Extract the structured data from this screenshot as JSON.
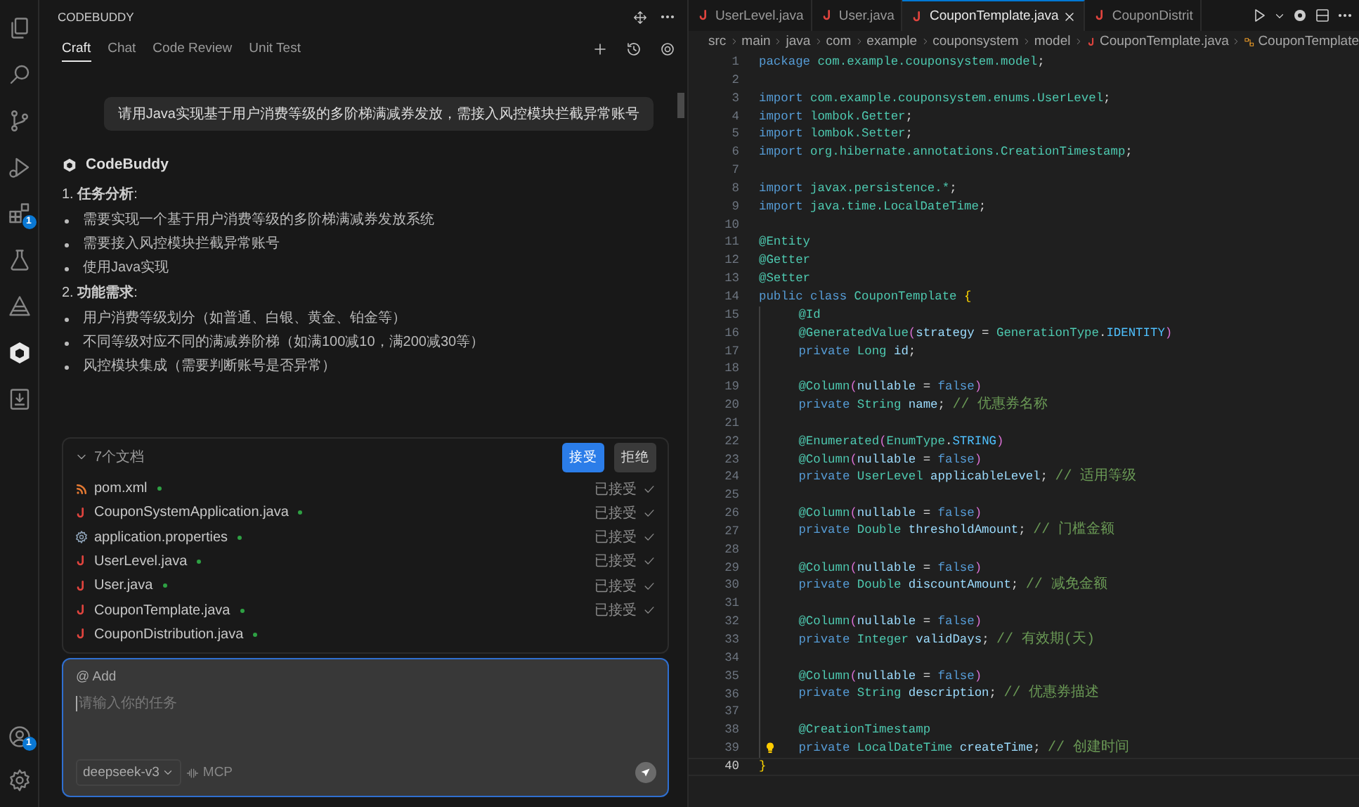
{
  "activity_bar": {
    "items": [
      {
        "kind": "files",
        "selected": false
      },
      {
        "kind": "search",
        "selected": false
      },
      {
        "kind": "branch",
        "selected": false
      },
      {
        "kind": "run",
        "selected": false
      },
      {
        "kind": "extensions",
        "selected": false,
        "badge": "1"
      },
      {
        "kind": "flask",
        "selected": false
      },
      {
        "kind": "triangle",
        "selected": false
      },
      {
        "kind": "cube",
        "selected": true
      },
      {
        "kind": "download",
        "selected": false
      }
    ],
    "bottom": [
      {
        "kind": "account",
        "badge": "1"
      },
      {
        "kind": "settings"
      }
    ]
  },
  "panel": {
    "title": "CODEBUDDY",
    "tabs": [
      {
        "label": "Craft",
        "selected": true
      },
      {
        "label": "Chat",
        "selected": false
      },
      {
        "label": "Code Review",
        "selected": false
      },
      {
        "label": "Unit Test",
        "selected": false
      }
    ],
    "chat": {
      "user_message": "请用Java实现基于用户消费等级的多阶梯满减券发放，需接入风控模块拦截异常账号",
      "assistant": "CodeBuddy",
      "blocks": [
        {
          "kind": "heading",
          "text": "1. **任务分析**:"
        },
        {
          "kind": "bullet",
          "text": "需要实现一个基于用户消费等级的多阶梯满减券发放系统"
        },
        {
          "kind": "bullet",
          "text": "需要接入风控模块拦截异常账号"
        },
        {
          "kind": "bullet",
          "text": "使用Java实现"
        },
        {
          "kind": "heading",
          "text": "2. **功能需求**:"
        },
        {
          "kind": "bullet",
          "text": "用户消费等级划分（如普通、白银、黄金、铂金等）"
        },
        {
          "kind": "bullet",
          "text": "不同等级对应不同的满减券阶梯（如满100减10，满200减30等）"
        },
        {
          "kind": "bullet",
          "text": "风控模块集成（需要判断账号是否异常）"
        }
      ]
    },
    "changes": {
      "title": "7个文档",
      "expanded": true,
      "accept": "接受",
      "reject": "拒绝",
      "files": [
        {
          "name": "pom.xml",
          "kind": "xml",
          "modified": true,
          "status": "已接受"
        },
        {
          "name": "CouponSystemApplication.java",
          "kind": "java",
          "modified": true,
          "status": "已接受"
        },
        {
          "name": "application.properties",
          "kind": "config",
          "modified": true,
          "status": "已接受"
        },
        {
          "name": "UserLevel.java",
          "kind": "java",
          "modified": true,
          "status": "已接受"
        },
        {
          "name": "User.java",
          "kind": "java",
          "modified": true,
          "status": "已接受"
        },
        {
          "name": "CouponTemplate.java",
          "kind": "java",
          "modified": true,
          "status": "已接受"
        },
        {
          "name": "CouponDistribution.java",
          "kind": "java",
          "modified": true
        }
      ]
    },
    "input": {
      "mention": "@ Add",
      "placeholder": "请输入你的任务",
      "model": "deepseek-v3",
      "tool": "MCP"
    }
  },
  "editor": {
    "tabs": [
      {
        "label": "UserLevel.java",
        "selected": false
      },
      {
        "label": "User.java",
        "selected": false
      },
      {
        "label": "CouponTemplate.java",
        "selected": true
      },
      {
        "label": "CouponDistrit",
        "selected": false
      }
    ],
    "breadcrumb": [
      {
        "text": "src",
        "kind": "folder"
      },
      {
        "text": "main",
        "kind": "folder"
      },
      {
        "text": "java",
        "kind": "folder"
      },
      {
        "text": "com",
        "kind": "folder"
      },
      {
        "text": "example",
        "kind": "folder"
      },
      {
        "text": "couponsystem",
        "kind": "folder"
      },
      {
        "text": "model",
        "kind": "folder"
      },
      {
        "text": "CouponTemplate.java",
        "kind": "file"
      },
      {
        "text": "CouponTemplate",
        "kind": "class"
      }
    ],
    "lines": [
      {
        "n": "1",
        "tokens": [
          {
            "text": "package",
            "kind": "kw"
          },
          {
            "text": " com.example.couponsystem.model",
            "kind": "ns"
          },
          {
            "text": ";",
            "kind": "p"
          }
        ]
      },
      {
        "n": "2"
      },
      {
        "n": "3",
        "tokens": [
          {
            "text": "import",
            "kind": "kw"
          },
          {
            "text": " com.example.couponsystem.enums.UserLevel",
            "kind": "ns"
          },
          {
            "text": ";",
            "kind": "p"
          }
        ]
      },
      {
        "n": "4",
        "tokens": [
          {
            "text": "import",
            "kind": "kw"
          },
          {
            "text": " lombok.Getter",
            "kind": "ns"
          },
          {
            "text": ";",
            "kind": "p"
          }
        ]
      },
      {
        "n": "5",
        "tokens": [
          {
            "text": "import",
            "kind": "kw"
          },
          {
            "text": " lombok.Setter",
            "kind": "ns"
          },
          {
            "text": ";",
            "kind": "p"
          }
        ]
      },
      {
        "n": "6",
        "tokens": [
          {
            "text": "import",
            "kind": "kw"
          },
          {
            "text": " org.hibernate.annotations.CreationTimestamp",
            "kind": "ns"
          },
          {
            "text": ";",
            "kind": "p"
          }
        ]
      },
      {
        "n": "7"
      },
      {
        "n": "8",
        "tokens": [
          {
            "text": "import",
            "kind": "kw"
          },
          {
            "text": " javax.persistence.*",
            "kind": "ns"
          },
          {
            "text": ";",
            "kind": "p"
          }
        ]
      },
      {
        "n": "9",
        "tokens": [
          {
            "text": "import",
            "kind": "kw"
          },
          {
            "text": " java.time.LocalDateTime",
            "kind": "ns"
          },
          {
            "text": ";",
            "kind": "p"
          }
        ]
      },
      {
        "n": "10"
      },
      {
        "n": "11",
        "tokens": [
          {
            "text": "@Entity",
            "kind": "ann"
          }
        ]
      },
      {
        "n": "12",
        "tokens": [
          {
            "text": "@Getter",
            "kind": "ann"
          }
        ]
      },
      {
        "n": "13",
        "tokens": [
          {
            "text": "@Setter",
            "kind": "ann"
          }
        ]
      },
      {
        "n": "14",
        "tokens": [
          {
            "text": "public class",
            "kind": "kw"
          },
          {
            "text": " CouponTemplate",
            "kind": "type"
          },
          {
            "text": " {",
            "kind": "br"
          }
        ]
      },
      {
        "n": "15",
        "guide": true,
        "tokens": [
          {
            "text": "@Id",
            "kind": "ann"
          }
        ]
      },
      {
        "n": "16",
        "guide": true,
        "tokens": [
          {
            "text": "@GeneratedValue",
            "kind": "ann"
          },
          {
            "text": "(",
            "kind": "br2"
          },
          {
            "text": "strategy",
            "kind": "var"
          },
          {
            "text": " = ",
            "kind": "p"
          },
          {
            "text": "GenerationType",
            "kind": "type"
          },
          {
            "text": ".",
            "kind": "p"
          },
          {
            "text": "IDENTITY",
            "kind": "const"
          },
          {
            "text": ")",
            "kind": "br2"
          }
        ]
      },
      {
        "n": "17",
        "guide": true,
        "tokens": [
          {
            "text": "private",
            "kind": "kw"
          },
          {
            "text": " Long",
            "kind": "type"
          },
          {
            "text": " id",
            "kind": "var"
          },
          {
            "text": ";",
            "kind": "p"
          }
        ]
      },
      {
        "n": "18",
        "guide": true
      },
      {
        "n": "19",
        "guide": true,
        "tokens": [
          {
            "text": "@Column",
            "kind": "ann"
          },
          {
            "text": "(",
            "kind": "br2"
          },
          {
            "text": "nullable",
            "kind": "var"
          },
          {
            "text": " = ",
            "kind": "p"
          },
          {
            "text": "false",
            "kind": "kw"
          },
          {
            "text": ")",
            "kind": "br2"
          }
        ]
      },
      {
        "n": "20",
        "guide": true,
        "tokens": [
          {
            "text": "private",
            "kind": "kw"
          },
          {
            "text": " String",
            "kind": "type"
          },
          {
            "text": " name",
            "kind": "var"
          },
          {
            "text": "; ",
            "kind": "p"
          },
          {
            "text": "// 优惠券名称",
            "kind": "cm"
          }
        ]
      },
      {
        "n": "21",
        "guide": true
      },
      {
        "n": "22",
        "guide": true,
        "tokens": [
          {
            "text": "@Enumerated",
            "kind": "ann"
          },
          {
            "text": "(",
            "kind": "br2"
          },
          {
            "text": "EnumType",
            "kind": "type"
          },
          {
            "text": ".",
            "kind": "p"
          },
          {
            "text": "STRING",
            "kind": "const"
          },
          {
            "text": ")",
            "kind": "br2"
          }
        ]
      },
      {
        "n": "23",
        "guide": true,
        "tokens": [
          {
            "text": "@Column",
            "kind": "ann"
          },
          {
            "text": "(",
            "kind": "br2"
          },
          {
            "text": "nullable",
            "kind": "var"
          },
          {
            "text": " = ",
            "kind": "p"
          },
          {
            "text": "false",
            "kind": "kw"
          },
          {
            "text": ")",
            "kind": "br2"
          }
        ]
      },
      {
        "n": "24",
        "guide": true,
        "tokens": [
          {
            "text": "private",
            "kind": "kw"
          },
          {
            "text": " UserLevel",
            "kind": "type"
          },
          {
            "text": " applicableLevel",
            "kind": "var"
          },
          {
            "text": "; ",
            "kind": "p"
          },
          {
            "text": "// 适用等级",
            "kind": "cm"
          }
        ]
      },
      {
        "n": "25",
        "guide": true
      },
      {
        "n": "26",
        "guide": true,
        "tokens": [
          {
            "text": "@Column",
            "kind": "ann"
          },
          {
            "text": "(",
            "kind": "br2"
          },
          {
            "text": "nullable",
            "kind": "var"
          },
          {
            "text": " = ",
            "kind": "p"
          },
          {
            "text": "false",
            "kind": "kw"
          },
          {
            "text": ")",
            "kind": "br2"
          }
        ]
      },
      {
        "n": "27",
        "guide": true,
        "tokens": [
          {
            "text": "private",
            "kind": "kw"
          },
          {
            "text": " Double",
            "kind": "type"
          },
          {
            "text": " thresholdAmount",
            "kind": "var"
          },
          {
            "text": "; ",
            "kind": "p"
          },
          {
            "text": "// 门槛金额",
            "kind": "cm"
          }
        ]
      },
      {
        "n": "28",
        "guide": true
      },
      {
        "n": "29",
        "guide": true,
        "tokens": [
          {
            "text": "@Column",
            "kind": "ann"
          },
          {
            "text": "(",
            "kind": "br2"
          },
          {
            "text": "nullable",
            "kind": "var"
          },
          {
            "text": " = ",
            "kind": "p"
          },
          {
            "text": "false",
            "kind": "kw"
          },
          {
            "text": ")",
            "kind": "br2"
          }
        ]
      },
      {
        "n": "30",
        "guide": true,
        "tokens": [
          {
            "text": "private",
            "kind": "kw"
          },
          {
            "text": " Double",
            "kind": "type"
          },
          {
            "text": " discountAmount",
            "kind": "var"
          },
          {
            "text": "; ",
            "kind": "p"
          },
          {
            "text": "// 减免金额",
            "kind": "cm"
          }
        ]
      },
      {
        "n": "31",
        "guide": true
      },
      {
        "n": "32",
        "guide": true,
        "tokens": [
          {
            "text": "@Column",
            "kind": "ann"
          },
          {
            "text": "(",
            "kind": "br2"
          },
          {
            "text": "nullable",
            "kind": "var"
          },
          {
            "text": " = ",
            "kind": "p"
          },
          {
            "text": "false",
            "kind": "kw"
          },
          {
            "text": ")",
            "kind": "br2"
          }
        ]
      },
      {
        "n": "33",
        "guide": true,
        "tokens": [
          {
            "text": "private",
            "kind": "kw"
          },
          {
            "text": " Integer",
            "kind": "type"
          },
          {
            "text": " validDays",
            "kind": "var"
          },
          {
            "text": "; ",
            "kind": "p"
          },
          {
            "text": "// 有效期(天)",
            "kind": "cm"
          }
        ]
      },
      {
        "n": "34",
        "guide": true
      },
      {
        "n": "35",
        "guide": true,
        "tokens": [
          {
            "text": "@Column",
            "kind": "ann"
          },
          {
            "text": "(",
            "kind": "br2"
          },
          {
            "text": "nullable",
            "kind": "var"
          },
          {
            "text": " = ",
            "kind": "p"
          },
          {
            "text": "false",
            "kind": "kw"
          },
          {
            "text": ")",
            "kind": "br2"
          }
        ]
      },
      {
        "n": "36",
        "guide": true,
        "tokens": [
          {
            "text": "private",
            "kind": "kw"
          },
          {
            "text": " String",
            "kind": "type"
          },
          {
            "text": " description",
            "kind": "var"
          },
          {
            "text": "; ",
            "kind": "p"
          },
          {
            "text": "// 优惠券描述",
            "kind": "cm"
          }
        ]
      },
      {
        "n": "37",
        "guide": true
      },
      {
        "n": "38",
        "guide": true,
        "tokens": [
          {
            "text": "@CreationTimestamp",
            "kind": "ann"
          }
        ]
      },
      {
        "n": "39",
        "guide": true,
        "hint": true,
        "tokens": [
          {
            "text": "private",
            "kind": "kw"
          },
          {
            "text": " LocalDateTime",
            "kind": "type"
          },
          {
            "text": " createTime",
            "kind": "var"
          },
          {
            "text": "; ",
            "kind": "p"
          },
          {
            "text": "// 创建时间",
            "kind": "cm"
          }
        ]
      },
      {
        "n": "40",
        "current": true,
        "tokens": [
          {
            "text": "}",
            "kind": "br"
          }
        ]
      }
    ]
  }
}
